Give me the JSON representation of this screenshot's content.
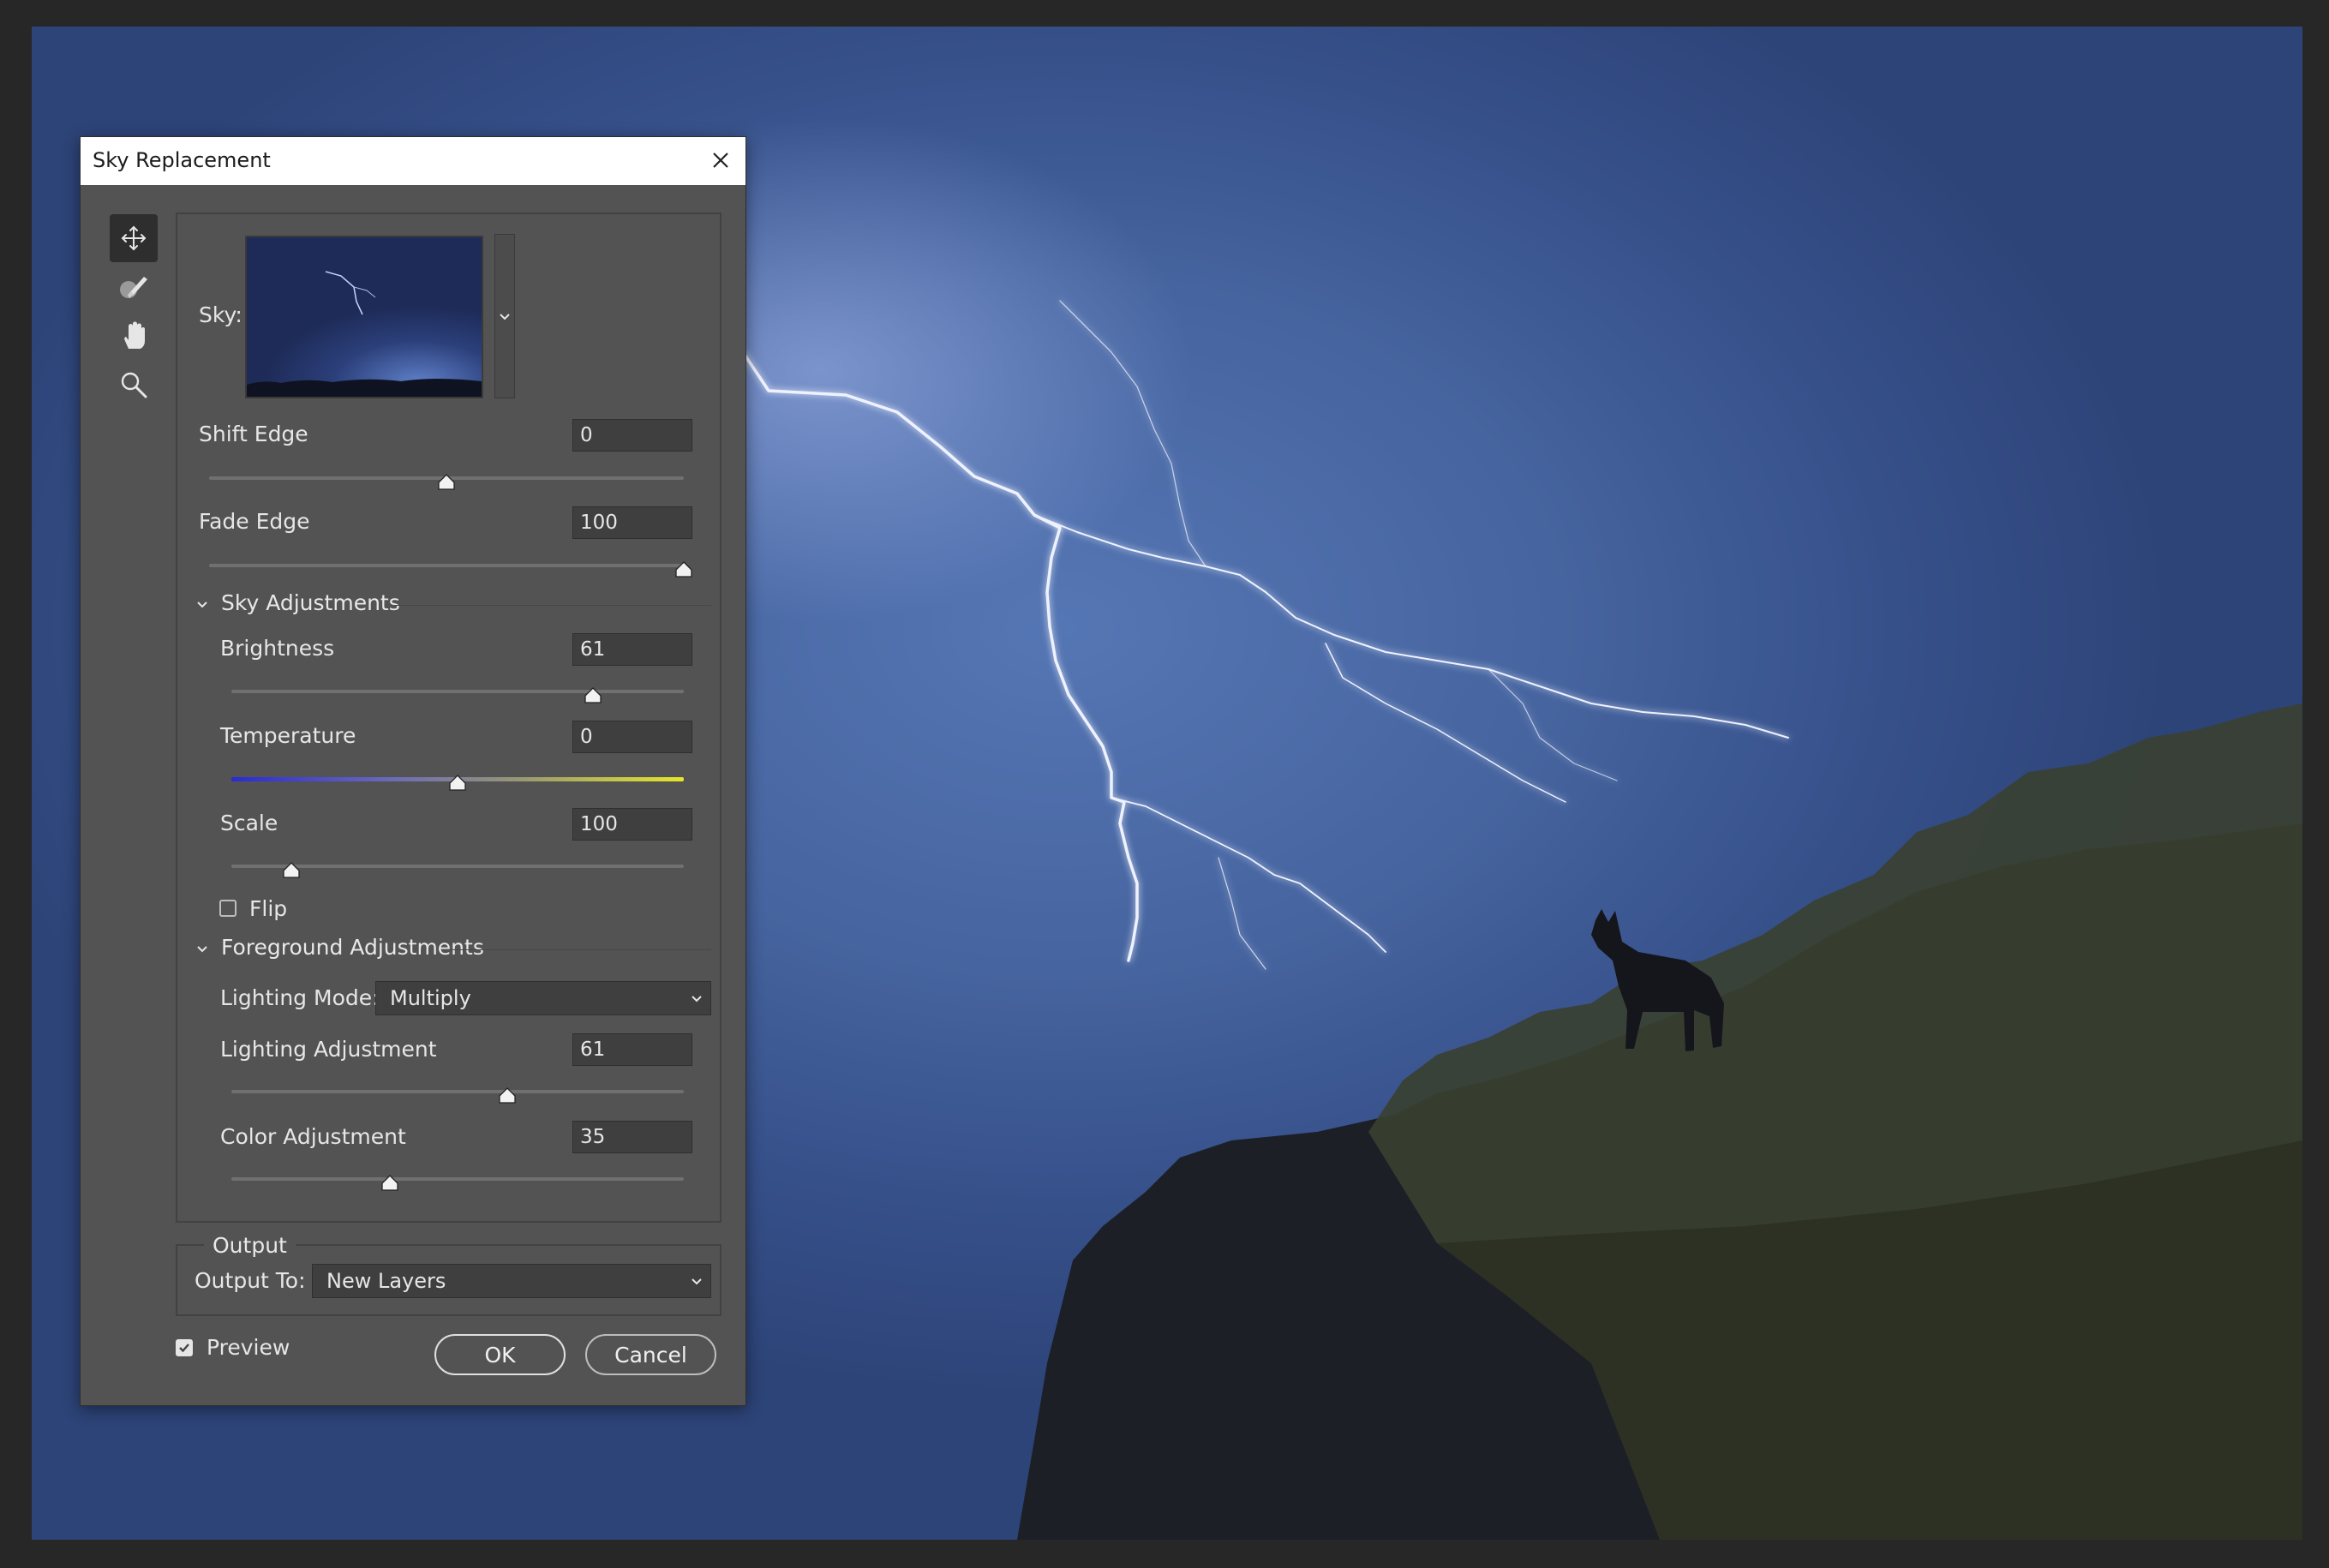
{
  "dialog": {
    "title": "Sky Replacement",
    "close_icon": "close-icon"
  },
  "tools": [
    {
      "name": "move-sky-tool",
      "icon": "move-icon",
      "active": true
    },
    {
      "name": "sky-brush-tool",
      "icon": "sky-brush-icon",
      "active": false
    },
    {
      "name": "hand-tool",
      "icon": "hand-icon",
      "active": false
    },
    {
      "name": "zoom-tool",
      "icon": "zoom-icon",
      "active": false
    }
  ],
  "sky": {
    "label": "Sky:"
  },
  "shift_edge": {
    "label": "Shift Edge",
    "value": "0",
    "level": 0.5
  },
  "fade_edge": {
    "label": "Fade Edge",
    "value": "100",
    "level": 1.0
  },
  "sky_adjustments": {
    "heading": "Sky Adjustments",
    "brightness": {
      "label": "Brightness",
      "value": "61",
      "level": 0.8
    },
    "temperature": {
      "label": "Temperature",
      "value": "0",
      "level": 0.5
    },
    "scale": {
      "label": "Scale",
      "value": "100",
      "level": 0.133
    },
    "flip": {
      "label": "Flip",
      "checked": false
    }
  },
  "foreground_adjustments": {
    "heading": "Foreground Adjustments",
    "lighting_mode": {
      "label": "Lighting Mode:",
      "value": "Multiply"
    },
    "lighting_adjustment": {
      "label": "Lighting Adjustment",
      "value": "61",
      "level": 0.61
    },
    "color_adjustment": {
      "label": "Color Adjustment",
      "value": "35",
      "level": 0.35
    }
  },
  "output": {
    "heading": "Output",
    "label": "Output To:",
    "value": "New Layers"
  },
  "preview": {
    "label": "Preview",
    "checked": true
  },
  "buttons": {
    "ok": "OK",
    "cancel": "Cancel"
  },
  "colors": {
    "dialog_bg": "#535353",
    "field_bg": "#3f3f3f",
    "sky_blue": "#46649f",
    "lightning": "#eef2ff"
  }
}
